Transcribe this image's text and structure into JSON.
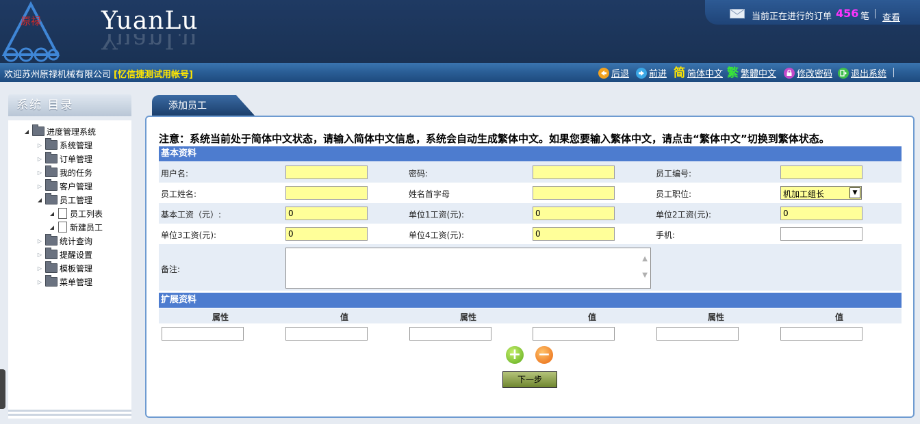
{
  "header": {
    "brand": "YuanLu",
    "logo_text": "原禄",
    "order_prefix": "当前正在进行的订单",
    "order_count": "456",
    "order_unit": "笔",
    "view_link": "查看"
  },
  "navbar": {
    "welcome": "欢迎苏州原禄机械有限公司",
    "account": "[忆信捷测试用帐号]",
    "items": [
      {
        "label": "后退",
        "icon": "back-arrow-icon"
      },
      {
        "label": "前进",
        "icon": "forward-arrow-icon"
      },
      {
        "label": "简体中文",
        "icon": "简"
      },
      {
        "label": "繁體中文",
        "icon": "繁"
      },
      {
        "label": "修改密码",
        "icon": "lock-icon"
      },
      {
        "label": "退出系统",
        "icon": "exit-icon"
      }
    ]
  },
  "sidebar": {
    "title": "系统 目录",
    "tree": {
      "root": "进度管理系统",
      "items": [
        {
          "label": "系统管理"
        },
        {
          "label": "订单管理"
        },
        {
          "label": "我的任务"
        },
        {
          "label": "客户管理"
        },
        {
          "label": "员工管理",
          "children": [
            "员工列表",
            "新建员工"
          ]
        },
        {
          "label": "统计查询"
        },
        {
          "label": "提醒设置"
        },
        {
          "label": "模板管理"
        },
        {
          "label": "菜单管理"
        }
      ]
    }
  },
  "main": {
    "tab": "添加员工",
    "notice": "注意：系统当前处于简体中文状态，请输入简体中文信息，系统会自动生成繁体中文。如果您要输入繁体中文，请点击“繁体中文”切换到繁体状态。",
    "basic": {
      "title": "基本资料",
      "fields": {
        "username": {
          "label": "用户名:",
          "value": ""
        },
        "password": {
          "label": "密码:",
          "value": ""
        },
        "emp_no": {
          "label": "员工编号:",
          "value": ""
        },
        "name": {
          "label": "员工姓名:",
          "value": ""
        },
        "initials": {
          "label": "姓名首字母",
          "value": ""
        },
        "position": {
          "label": "员工职位:",
          "value": "机加工组长"
        },
        "base_salary": {
          "label": "基本工资（元）:",
          "value": "0"
        },
        "unit1_salary": {
          "label": "单位1工资(元):",
          "value": "0"
        },
        "unit2_salary": {
          "label": "单位2工资(元):",
          "value": "0"
        },
        "unit3_salary": {
          "label": "单位3工资(元):",
          "value": "0"
        },
        "unit4_salary": {
          "label": "单位4工资(元):",
          "value": "0"
        },
        "mobile": {
          "label": "手机:",
          "value": ""
        },
        "remark": {
          "label": "备注:",
          "value": ""
        }
      }
    },
    "extended": {
      "title": "扩展资料",
      "columns": [
        "属性",
        "值",
        "属性",
        "值",
        "属性",
        "值"
      ]
    },
    "next_button": "下一步"
  },
  "colors": {
    "header_bg": "#1c355a",
    "section_blue": "#4d7ccf",
    "input_yellow": "#ffff99",
    "order_count": "#ff33ff",
    "account_yellow": "#ffe600"
  }
}
